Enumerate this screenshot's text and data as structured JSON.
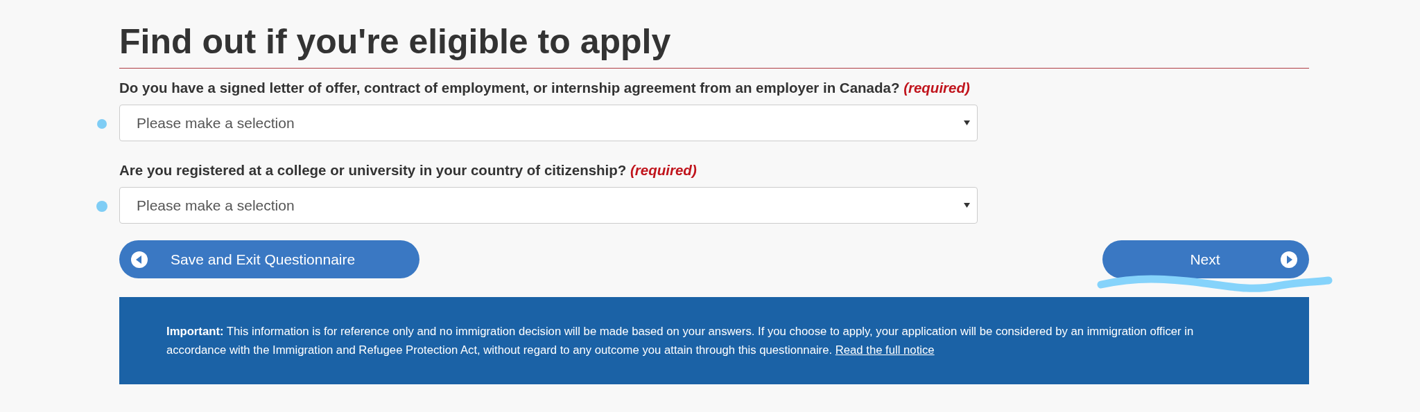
{
  "title": "Find out if you're eligible to apply",
  "questions": [
    {
      "label": "Do you have a signed letter of offer, contract of employment, or internship agreement from an employer in Canada?",
      "required": "(required)",
      "placeholder": "Please make a selection"
    },
    {
      "label": "Are you registered at a college or university in your country of citizenship?",
      "required": "(required)",
      "placeholder": "Please make a selection"
    }
  ],
  "buttons": [
    {
      "kind": "back",
      "label": "Save and Exit Questionnaire"
    },
    {
      "kind": "next",
      "label": "Next"
    }
  ],
  "notice": {
    "text": "**Important:** This information is for reference only and no immigration decision will be made based on your answers. If you choose to apply, your application will be considered by an immigration officer in accordance with the Immigration and Refugee Protection Act, without regard to any outcome you attain through this questionnaire.",
    "link": "Read the full notice"
  }
}
